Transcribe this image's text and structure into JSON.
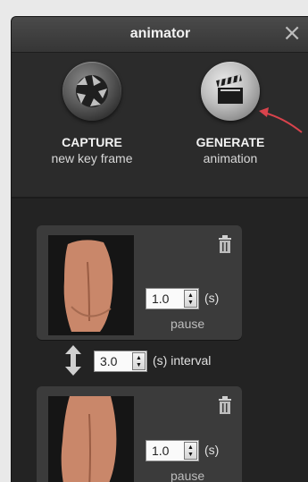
{
  "window": {
    "title": "animator",
    "close_glyph": "×"
  },
  "toolbar": {
    "capture": {
      "label": "CAPTURE",
      "sub": "new key frame",
      "icon": "aperture-icon"
    },
    "generate": {
      "label": "GENERATE",
      "sub": "animation",
      "icon": "clapperboard-icon"
    }
  },
  "frames": [
    {
      "pause_value": "1.0",
      "unit": "(s)",
      "pause_label": "pause"
    },
    {
      "pause_value": "1.0",
      "unit": "(s)",
      "pause_label": "pause"
    }
  ],
  "interval": {
    "value": "3.0",
    "label": "(s) interval"
  },
  "colors": {
    "annotation_arrow": "#d9434c",
    "panel": "#2f2f2f",
    "card": "#3b3b3b"
  }
}
